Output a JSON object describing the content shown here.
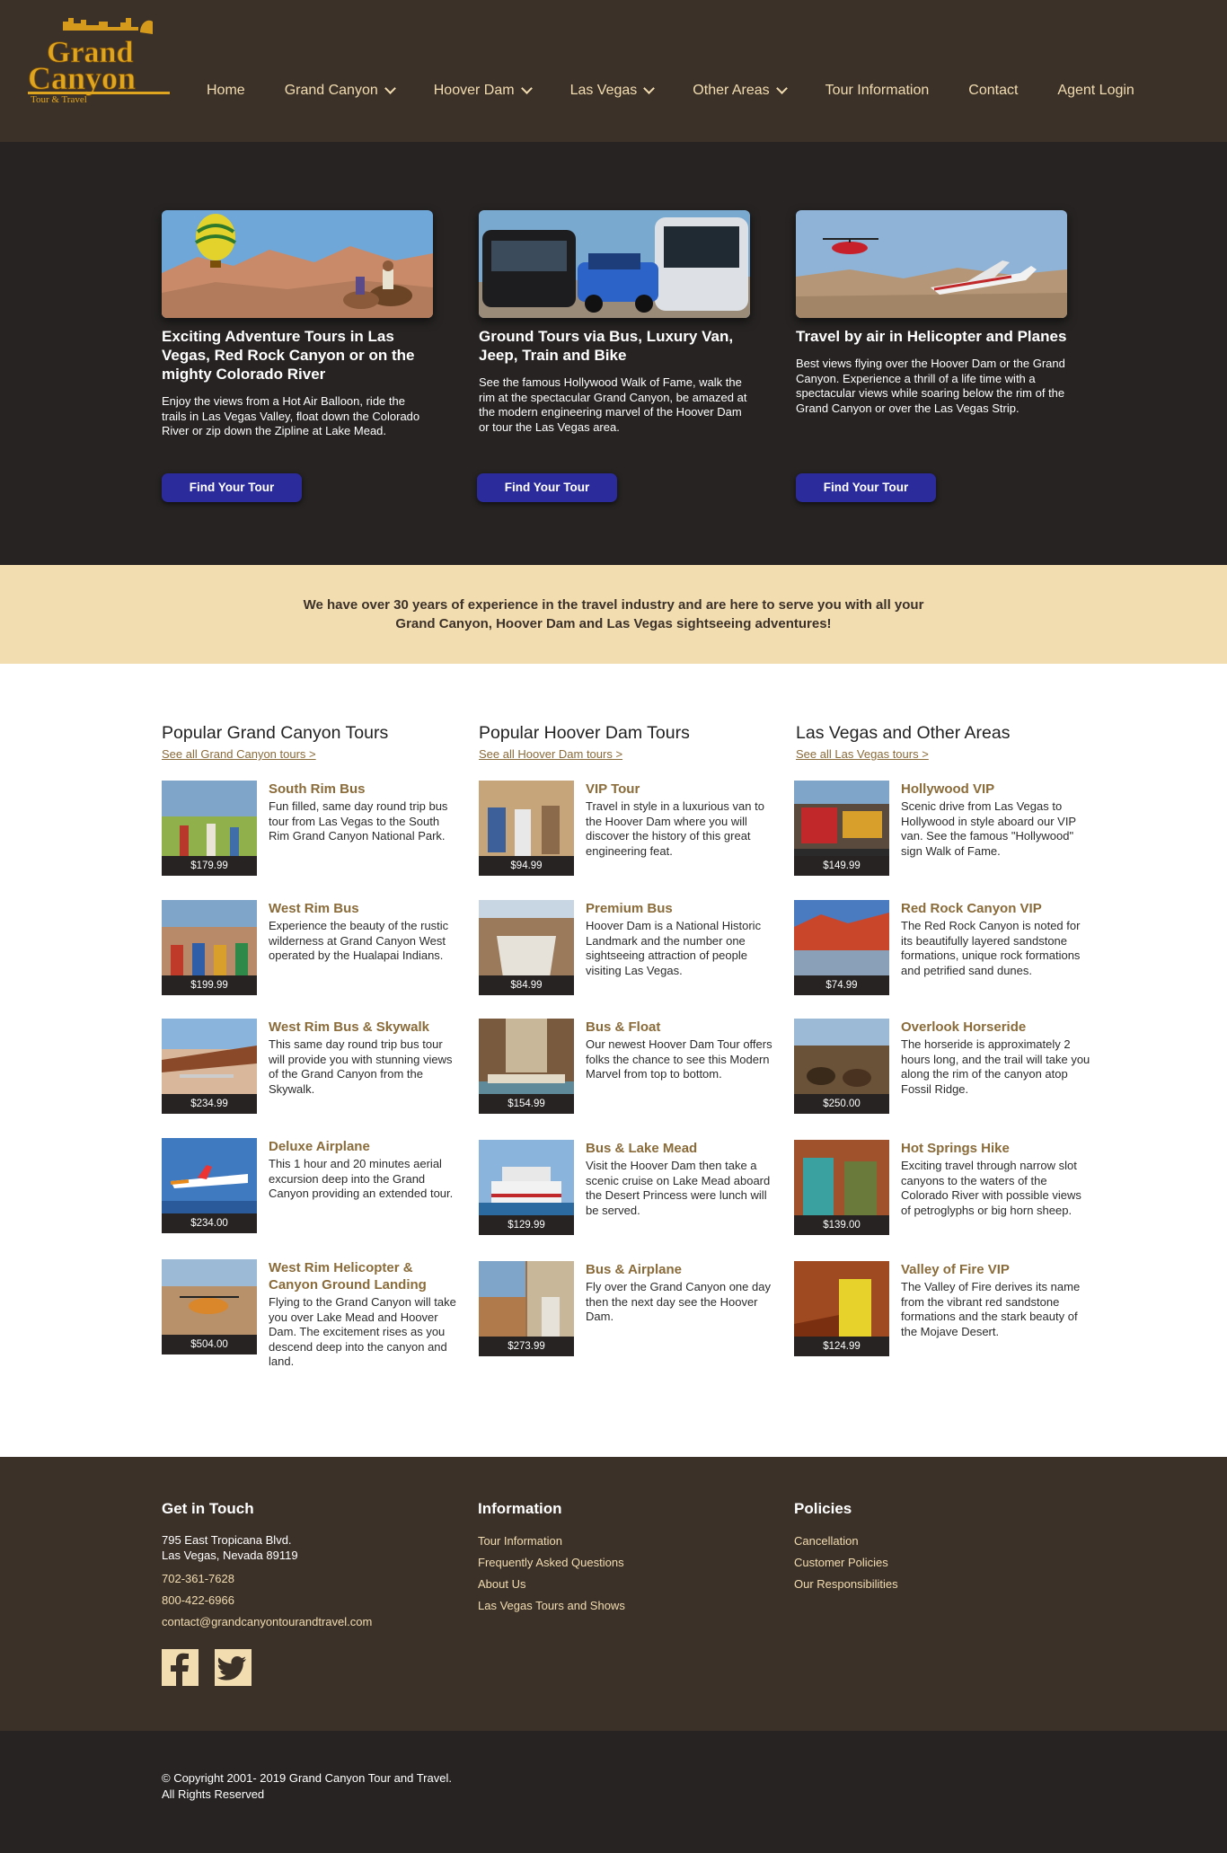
{
  "brand": {
    "line1": "Grand",
    "line2": "Canyon",
    "line3": "Tour & Travel"
  },
  "nav": [
    {
      "label": "Home",
      "dropdown": false
    },
    {
      "label": "Grand Canyon",
      "dropdown": true
    },
    {
      "label": "Hoover Dam",
      "dropdown": true
    },
    {
      "label": "Las Vegas",
      "dropdown": true
    },
    {
      "label": "Other Areas",
      "dropdown": true
    },
    {
      "label": "Tour Information",
      "dropdown": false
    },
    {
      "label": "Contact",
      "dropdown": false
    },
    {
      "label": "Agent Login",
      "dropdown": false
    }
  ],
  "hero": [
    {
      "title": "Exciting Adventure Tours in Las Vegas, Red Rock Canyon or on the mighty Colorado River",
      "text": "Enjoy the views from a Hot Air Balloon, ride the trails in Las Vegas Valley, float down the Colorado River or zip down the Zipline at Lake Mead.",
      "button": "Find Your Tour"
    },
    {
      "title": "Ground Tours via Bus, Luxury Van, Jeep, Train and Bike",
      "text": "See the famous Hollywood Walk of Fame, walk the rim at the spectacular Grand Canyon, be amazed at the modern engineering marvel of the Hoover Dam or tour the Las Vegas area.",
      "button": "Find Your Tour"
    },
    {
      "title": "Travel by air in Helicopter and Planes",
      "text": "Best views flying over the Hoover Dam or the Grand Canyon. Experience a thrill of a life time with a spectacular views while soaring below the rim of the Grand Canyon or over the Las Vegas Strip.",
      "button": "Find Your Tour"
    }
  ],
  "banner": {
    "line1": "We have over 30 years of experience in the travel industry and are here to serve you with all your",
    "line2": "Grand Canyon, Hoover Dam and Las Vegas sightseeing adventures!"
  },
  "columns": [
    {
      "title": "Popular Grand Canyon Tours",
      "link": "See all Grand Canyon tours >",
      "tours": [
        {
          "name": "South Rim Bus",
          "desc": "Fun filled, same day round trip bus tour from Las Vegas to the South Rim Grand Canyon National Park.",
          "price": "$179.99"
        },
        {
          "name": "West Rim Bus",
          "desc": "Experience the beauty of the rustic wilderness at Grand Canyon West operated by the Hualapai Indians.",
          "price": "$199.99"
        },
        {
          "name": "West Rim Bus & Skywalk",
          "desc": "This same day round trip bus tour will provide you with stunning views of the Grand Canyon from the Skywalk.",
          "price": "$234.99"
        },
        {
          "name": "Deluxe Airplane",
          "desc": "This 1 hour and 20 minutes aerial excursion deep into the Grand Canyon providing an extended tour.",
          "price": "$234.00"
        },
        {
          "name": "West Rim Helicopter & Canyon Ground Landing",
          "desc": "Flying to the Grand Canyon will take you over Lake Mead and Hoover Dam. The excitement rises as you descend deep into the canyon and land.",
          "price": "$504.00"
        }
      ]
    },
    {
      "title": "Popular Hoover Dam Tours",
      "link": "See all Hoover Dam tours >",
      "tours": [
        {
          "name": "VIP Tour",
          "desc": "Travel in style in a luxurious van to the Hoover Dam where you will discover the history of this great engineering feat.",
          "price": "$94.99"
        },
        {
          "name": "Premium Bus",
          "desc": "Hoover Dam is a National Historic Landmark and the number one sightseeing attraction of people visiting Las Vegas.",
          "price": "$84.99"
        },
        {
          "name": "Bus & Float",
          "desc": "Our newest Hoover Dam Tour offers folks the chance to see this Modern Marvel from top to bottom.",
          "price": "$154.99"
        },
        {
          "name": "Bus & Lake Mead",
          "desc": "Visit the Hoover Dam then take a scenic cruise on Lake Mead aboard the Desert Princess were lunch will be served.",
          "price": "$129.99"
        },
        {
          "name": "Bus & Airplane",
          "desc": "Fly over the Grand Canyon one day then the next day see the Hoover Dam.",
          "price": "$273.99"
        }
      ]
    },
    {
      "title": "Las Vegas and Other Areas",
      "link": "See all Las Vegas tours >",
      "tours": [
        {
          "name": "Hollywood VIP",
          "desc": "Scenic drive from Las Vegas to Hollywood in style aboard our VIP van. See the famous \"Hollywood\" sign Walk of Fame.",
          "price": "$149.99"
        },
        {
          "name": "Red Rock Canyon VIP",
          "desc": "The Red Rock Canyon is noted for its beautifully layered sandstone formations, unique rock formations and petrified sand dunes.",
          "price": "$74.99"
        },
        {
          "name": "Overlook Horseride",
          "desc": "The horseride is approximately 2 hours long, and the trail will take you along the rim of the canyon atop Fossil Ridge.",
          "price": "$250.00"
        },
        {
          "name": "Hot Springs Hike",
          "desc": "Exciting travel through narrow slot canyons to the waters of the Colorado River with possible views of petroglyphs or big horn sheep.",
          "price": "$139.00"
        },
        {
          "name": "Valley of Fire VIP",
          "desc": "The Valley of Fire derives its name from the vibrant red sandstone formations and the stark beauty of the Mojave Desert.",
          "price": "$124.99"
        }
      ]
    }
  ],
  "footer": {
    "contact": {
      "title": "Get in Touch",
      "address1": "795 East Tropicana Blvd.",
      "address2": "Las Vegas, Nevada 89119",
      "phone1": "702-361-7628",
      "phone2": "800-422-6966",
      "email": "contact@grandcanyontourandtravel.com"
    },
    "information": {
      "title": "Information",
      "links": [
        "Tour Information",
        "Frequently Asked Questions",
        "About Us",
        "Las Vegas Tours and Shows"
      ]
    },
    "policies": {
      "title": "Policies",
      "links": [
        "Cancellation",
        "Customer Policies",
        "Our Responsibilities"
      ]
    },
    "social": [
      "facebook-icon",
      "twitter-icon"
    ]
  },
  "copyright": {
    "line1": "© Copyright 2001- 2019 Grand Canyon Tour and Travel.",
    "line2": "All Rights Reserved"
  },
  "colors": {
    "header_bg": "#3c3129",
    "hero_bg": "#262322",
    "banner_bg": "#f2ddb0",
    "accent_gold": "#8a6b3a",
    "button": "#2b2b9c"
  }
}
